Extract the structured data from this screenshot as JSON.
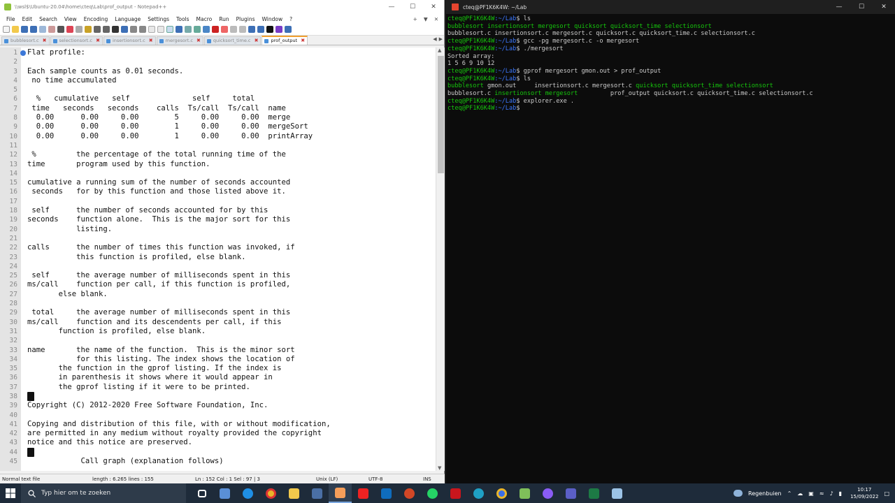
{
  "npp": {
    "title": "\\\\wsl$\\Ubuntu-20.04\\home\\cteq\\Lab\\prof_output - Notepad++",
    "menu": [
      "File",
      "Edit",
      "Search",
      "View",
      "Encoding",
      "Language",
      "Settings",
      "Tools",
      "Macro",
      "Run",
      "Plugins",
      "Window",
      "?"
    ],
    "tabs": [
      {
        "label": "bubblesort.c",
        "active": false
      },
      {
        "label": "selectionsort.c",
        "active": false
      },
      {
        "label": "insertionsort.c",
        "active": false
      },
      {
        "label": "mergesort.c",
        "active": false
      },
      {
        "label": "quicksort_time.c",
        "active": false
      },
      {
        "label": "prof_output",
        "active": true
      }
    ],
    "lines": [
      "Flat profile:",
      "",
      "Each sample counts as 0.01 seconds.",
      " no time accumulated",
      "",
      "  %   cumulative   self              self     total           ",
      " time   seconds   seconds    calls  Ts/call  Ts/call  name    ",
      "  0.00      0.00     0.00        5     0.00     0.00  merge",
      "  0.00      0.00     0.00        1     0.00     0.00  mergeSort",
      "  0.00      0.00     0.00        1     0.00     0.00  printArray",
      "",
      " %         the percentage of the total running time of the",
      "time       program used by this function.",
      "",
      "cumulative a running sum of the number of seconds accounted",
      " seconds   for by this function and those listed above it.",
      "",
      " self      the number of seconds accounted for by this",
      "seconds    function alone.  This is the major sort for this",
      "           listing.",
      "",
      "calls      the number of times this function was invoked, if",
      "           this function is profiled, else blank.",
      "",
      " self      the average number of milliseconds spent in this",
      "ms/call    function per call, if this function is profiled,",
      "       else blank.",
      "",
      " total     the average number of milliseconds spent in this",
      "ms/call    function and its descendents per call, if this",
      "       function is profiled, else blank.",
      "",
      "name       the name of the function.  This is the minor sort",
      "           for this listing. The index shows the location of",
      "       the function in the gprof listing. If the index is",
      "       in parenthesis it shows where it would appear in",
      "       the gprof listing if it were to be printed.",
      "FF",
      "Copyright (C) 2012-2020 Free Software Foundation, Inc.",
      "",
      "Copying and distribution of this file, with or without modification,",
      "are permitted in any medium without royalty provided the copyright",
      "notice and this notice are preserved.",
      "FF",
      "            Call graph (explanation follows)"
    ],
    "status": {
      "type": "Normal text file",
      "length": "length : 6.265    lines : 155",
      "position": "Ln : 152    Col : 1    Sel : 97 | 3",
      "eol": "Unix (LF)",
      "encoding": "UTF-8",
      "mode": "INS"
    }
  },
  "terminal": {
    "title": "cteq@PF1K6K4W: ~/Lab",
    "prompt_user": "cteq@PF1K6K4W",
    "prompt_path": ":~/Lab",
    "cmd_ls": "ls",
    "ls1": [
      "bubblesort",
      "insertionsort",
      "mergesort",
      "quicksort",
      "quicksort_time",
      "selectionsort"
    ],
    "ls2": [
      "bubblesort.c",
      "insertionsort.c",
      "mergesort.c",
      "quicksort.c",
      "quicksort_time.c",
      "selectionsort.c"
    ],
    "cmd_gcc": "gcc -pg mergesort.c -o mergesort",
    "cmd_run": "./mergesort",
    "out1": "Sorted array:",
    "out2": "1 5 6 9 10 12",
    "cmd_gprof": "gprof mergesort gmon.out > prof_output",
    "ls3": [
      "bubblesort",
      "gmon.out",
      "insertionsort.c",
      "mergesort.c",
      "quicksort",
      "quicksort_time",
      "selectionsort"
    ],
    "ls4": [
      "bubblesort.c",
      "insertionsort",
      "mergesort",
      "prof_output",
      "quicksort.c",
      "quicksort_time.c",
      "selectionsort.c"
    ],
    "cmd_explorer": "explorer.exe ."
  },
  "taskbar": {
    "search_placeholder": "Typ hier om te zoeken",
    "weather": "Regenbuien",
    "time": "10:17",
    "date": "15/09/2022"
  }
}
